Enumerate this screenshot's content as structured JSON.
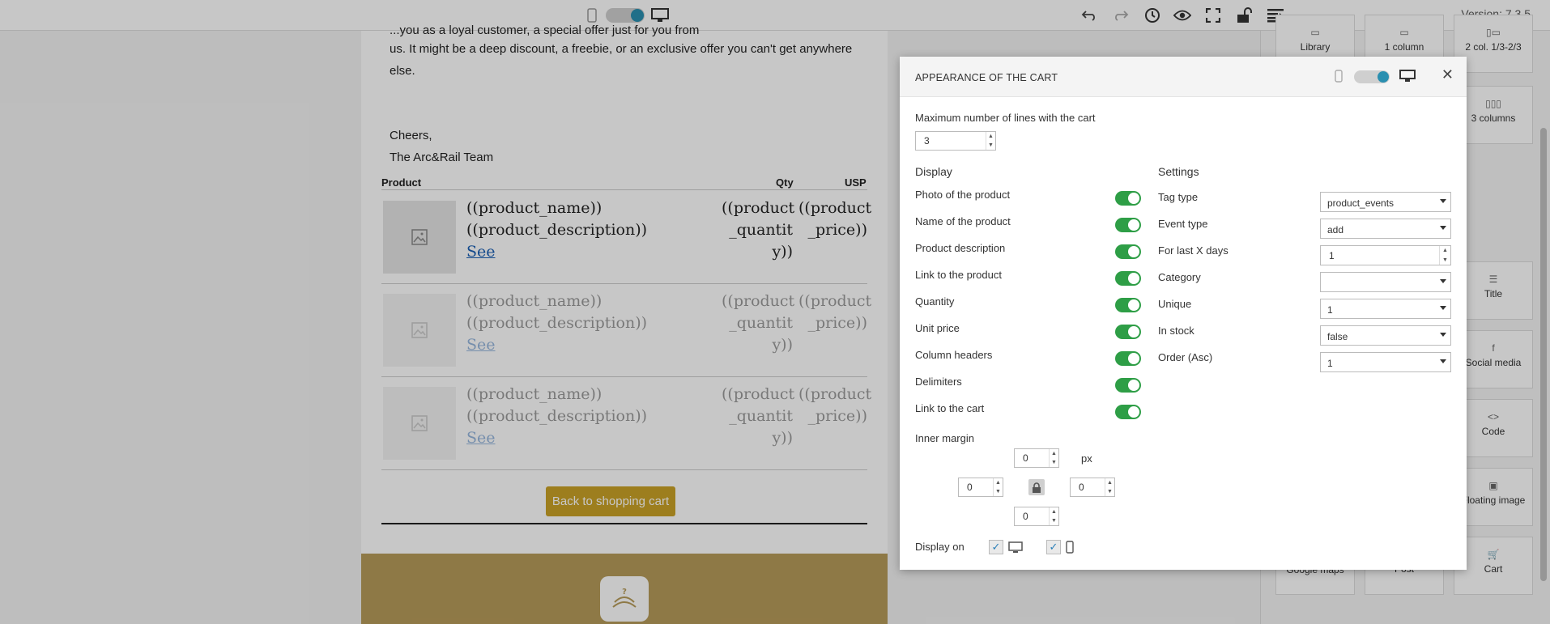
{
  "app": {
    "version": "Version: 7.3.5"
  },
  "email": {
    "intro_line1": "...you as a loyal customer, a special offer just for you from",
    "intro_line2": "us. It might be a deep discount, a freebie, or an exclusive offer you can't get anywhere",
    "intro_line3": "else.",
    "signoff": "Cheers,",
    "team": "The Arc&Rail Team",
    "headers": {
      "product": "Product",
      "qty": "Qty",
      "usp": "USP"
    },
    "rows": [
      {
        "name": "((product_name))",
        "description": "((product_description))",
        "link": "See",
        "qty": "((product _quantit y))",
        "price": "((product _price))"
      },
      {
        "name": "((product_name))",
        "description": "((product_description))",
        "link": "See",
        "qty": "((product _quantit y))",
        "price": "((product _price))"
      },
      {
        "name": "((product_name))",
        "description": "((product_description))",
        "link": "See",
        "qty": "((product _quantit y))",
        "price": "((product _price))"
      }
    ],
    "back_button": "Back to shopping cart",
    "logo_text": "?\n?"
  },
  "right_panel": {
    "blocks": [
      {
        "label": "Library"
      },
      {
        "label": "1 column"
      },
      {
        "label": "2 col. 1/3-2/3"
      },
      {
        "label": "3 columns"
      },
      {
        "label": "Title"
      },
      {
        "label": "Social media"
      },
      {
        "label": "Code"
      },
      {
        "label": "Floating image"
      },
      {
        "label": "Google maps"
      },
      {
        "label": "Post"
      },
      {
        "label": "Cart"
      }
    ]
  },
  "modal": {
    "title": "APPEARANCE OF THE CART",
    "max_lines_label": "Maximum number of lines with the cart",
    "max_lines_value": "3",
    "display_heading": "Display",
    "settings_heading": "Settings",
    "display_options": [
      {
        "label": "Photo of the product",
        "on": true
      },
      {
        "label": "Name of the product",
        "on": true
      },
      {
        "label": "Product description",
        "on": true
      },
      {
        "label": "Link to the product",
        "on": true
      },
      {
        "label": "Quantity",
        "on": true
      },
      {
        "label": "Unit price",
        "on": true
      },
      {
        "label": "Column headers",
        "on": true
      },
      {
        "label": "Delimiters",
        "on": true
      },
      {
        "label": "Link to the cart",
        "on": true
      }
    ],
    "settings": [
      {
        "label": "Tag type",
        "value": "product_events",
        "kind": "select"
      },
      {
        "label": "Event type",
        "value": "add",
        "kind": "select"
      },
      {
        "label": "For last X days",
        "value": "1",
        "kind": "number"
      },
      {
        "label": "Category",
        "value": "",
        "kind": "select"
      },
      {
        "label": "Unique",
        "value": "1",
        "kind": "select"
      },
      {
        "label": "In stock",
        "value": "false",
        "kind": "select"
      },
      {
        "label": "Order (Asc)",
        "value": "1",
        "kind": "select"
      }
    ],
    "inner_margin_label": "Inner margin",
    "margin": {
      "top": "0",
      "left": "0",
      "right": "0",
      "bottom": "0",
      "unit": "px"
    },
    "display_on_label": "Display on"
  },
  "colors": {
    "accent_teal": "#2a8fb0",
    "toggle_green": "#2e9e46",
    "button_gold": "#c9a227"
  }
}
